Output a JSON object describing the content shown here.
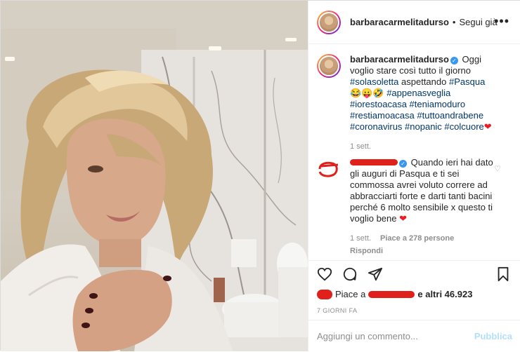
{
  "post": {
    "username": "barbaracarmelitadurso",
    "follow_status": "Segui già",
    "more_label": "•••"
  },
  "caption": {
    "username": "barbaracarmelitadurso",
    "text_before": "Oggi voglio stare così tutto il giorno",
    "tag1": "#solasoletta",
    "text_mid": "aspettando",
    "tag2": "#Pasqua",
    "emojis": "😂😛🤣",
    "tags_line": "#appenasveglia #iorestoacasa #teniamoduro #restiamoacasa #tuttoandrabene #coronavirus #nopanic #colcuore",
    "heart": "❤",
    "time": "1 sett."
  },
  "comment": {
    "text": "Quando ieri hai dato gli auguri di Pasqua e ti sei commossa avrei voluto correre ad abbracciarti forte e darti tanti bacini perché 6 molto sensibile x questo ti voglio bene",
    "heart": "❤",
    "time": "1 sett.",
    "likes": "Piace a 278 persone",
    "reply": "Rispondi"
  },
  "likes": {
    "prefix": "Piace a",
    "suffix": "e altri 46.923"
  },
  "date": "7 GIORNI FA",
  "add_comment": {
    "placeholder": "Aggiungi un commento...",
    "publish": "Pubblica"
  },
  "colors": {
    "link": "#00376b",
    "verified": "#3897f0",
    "redaction": "#e0201b",
    "publish_disabled": "#b2dffc"
  }
}
